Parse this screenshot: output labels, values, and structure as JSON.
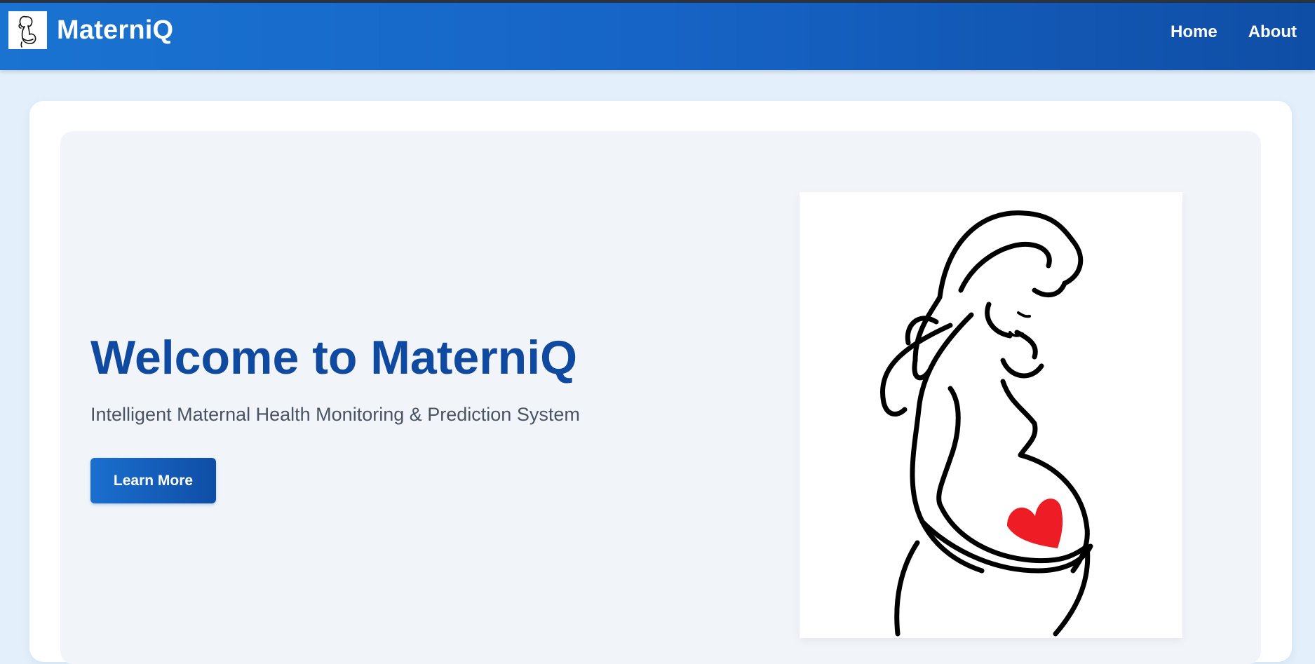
{
  "navbar": {
    "brand_name": "MaterniQ",
    "logo_icon": "pregnant-woman-icon",
    "links": [
      {
        "label": "Home"
      },
      {
        "label": "About"
      }
    ],
    "colors": {
      "gradient_start": "#1a73d1",
      "gradient_end": "#0f4ea6"
    }
  },
  "hero": {
    "title": "Welcome to MaterniQ",
    "subtitle": "Intelligent Maternal Health Monitoring & Prediction System",
    "cta_label": "Learn More",
    "illustration": "pregnant-woman-heart-illustration",
    "colors": {
      "title": "#0f4aa0",
      "heart": "#ee1c25"
    }
  }
}
